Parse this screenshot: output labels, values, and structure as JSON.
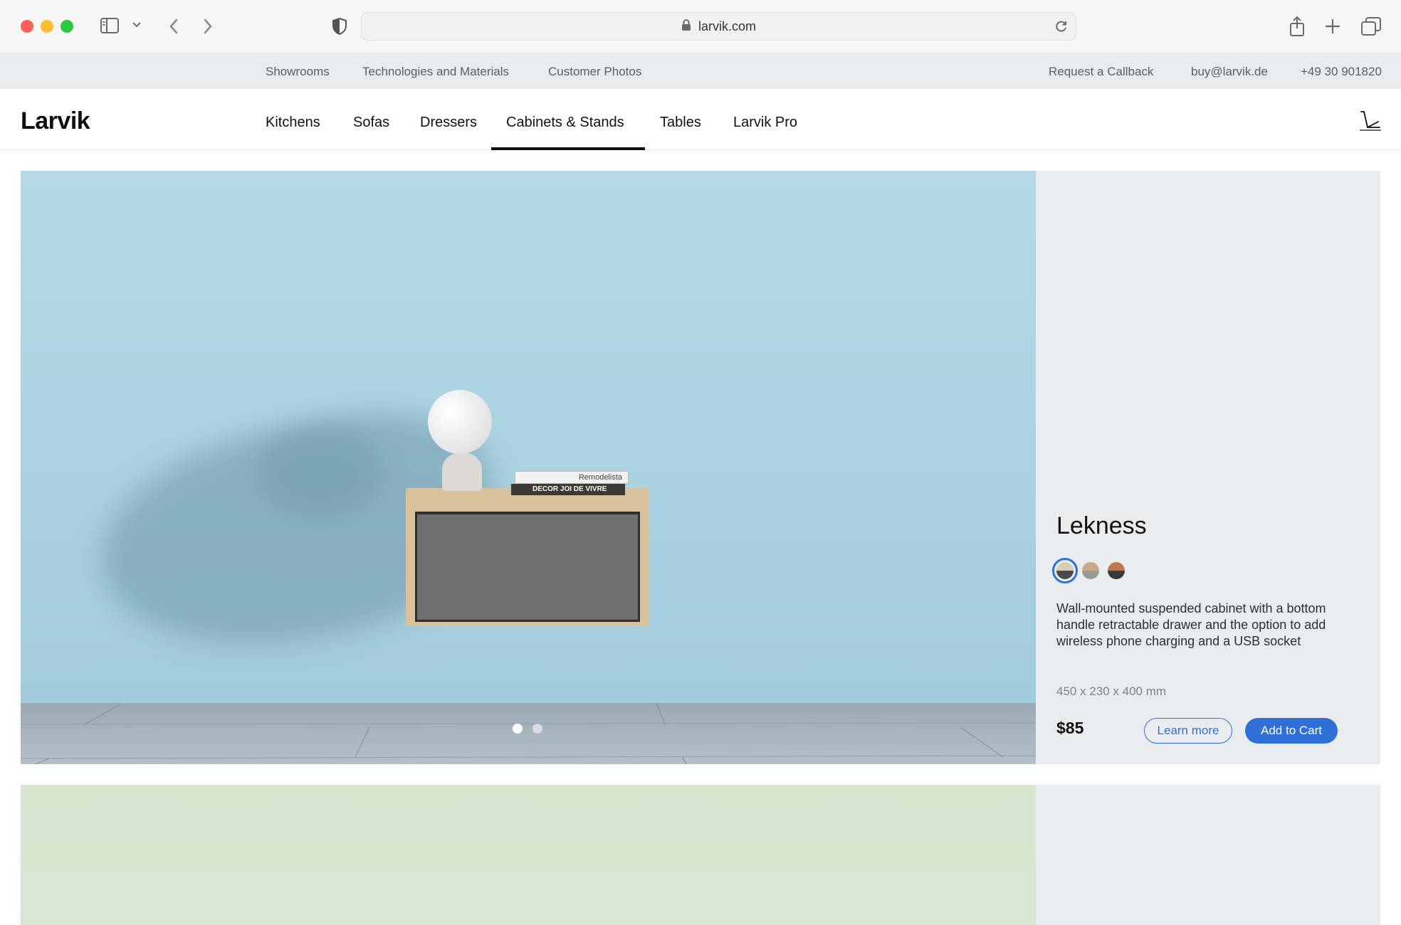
{
  "browser": {
    "url": "larvik.com"
  },
  "utility_bar": {
    "left_links": [
      "Showrooms",
      "Technologies and Materials",
      "Customer Photos"
    ],
    "request_callback": "Request a Callback",
    "email": "buy@larvik.de",
    "phone": "+49 30 901820"
  },
  "nav": {
    "logo": "Larvik",
    "items": [
      "Kitchens",
      "Sofas",
      "Dressers",
      "Cabinets & Stands",
      "Tables",
      "Larvik Pro"
    ],
    "active": "Cabinets & Stands"
  },
  "product": {
    "name": "Lekness",
    "swatches": [
      {
        "top": "#d9cdb8",
        "bottom": "#4a4a4a",
        "selected": true
      },
      {
        "top": "#c8a989",
        "bottom": "#9a9a92",
        "selected": false
      },
      {
        "top": "#c1784a",
        "bottom": "#3a3a3a",
        "selected": false
      }
    ],
    "description": "Wall-mounted suspended cabinet with a bottom handle retractable drawer and the option to add wireless phone charging and a USB socket",
    "dimensions": "450 x 230 x 400 mm",
    "price": "$85",
    "learn_more": "Learn more",
    "add_to_cart": "Add to Cart",
    "carousel_dots": 2,
    "carousel_active": 0,
    "photo_book_top": "Remodelista",
    "photo_book_bottom": "DECOR   JOI DE VIVRE"
  },
  "colors": {
    "accent": "#2f6fd6",
    "utility_bg": "#e9ecee",
    "card_bg": "#e9edf0"
  },
  "icons": [
    "sidebar-icon",
    "chevron-down-icon",
    "back-icon",
    "forward-icon",
    "shield-icon",
    "lock-icon",
    "reload-icon",
    "share-icon",
    "plus-icon",
    "tabs-icon",
    "cart-icon"
  ]
}
